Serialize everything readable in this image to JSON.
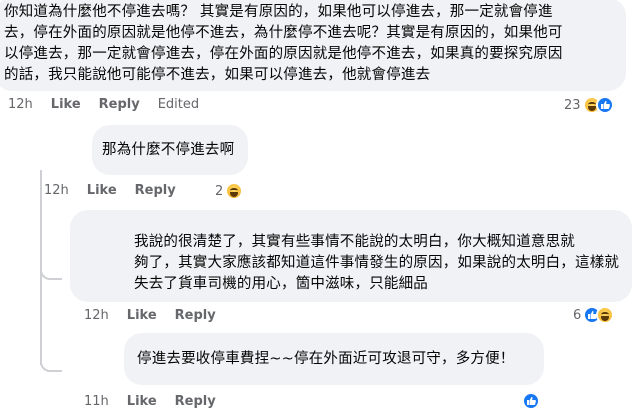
{
  "comments": [
    {
      "lines": [
        "你知道為什麼他不停進去嗎？ 其實是有原因的，如果他可以停進去，那一定就會停進",
        "去，停在外面的原因就是他停不進去，為什麼停不進去呢？其實是有原因的，如果他可",
        "以停進去，那一定就會停進去，停在外面的原因就是他停不進去，如果真的要探究原因",
        "的話，我只能說他可能停不進去，如果可以停進去，他就會停進去"
      ],
      "time": "12h",
      "like": "Like",
      "reply": "Reply",
      "edited": "Edited",
      "reaction_count": "23"
    },
    {
      "lines": [
        "那為什麼不停進去啊"
      ],
      "time": "12h",
      "like": "Like",
      "reply": "Reply",
      "reaction_count": "2"
    },
    {
      "lines": [
        "我說的很清楚了，其實有些事情不能說的太明白，你大概知道意思就",
        "夠了，其實大家應該都知道這件事情發生的原因，如果說的太明白，這樣就",
        "失去了貨車司機的用心，箇中滋味，只能細品"
      ],
      "time": "12h",
      "like": "Like",
      "reply": "Reply",
      "reaction_count": "6"
    },
    {
      "lines": [
        "停進去要收停車費捏~~停在外面近可攻退可守，多方便！"
      ],
      "time": "11h",
      "like": "Like",
      "reply": "Reply"
    }
  ],
  "icons": {
    "haha": "haha-reaction-icon",
    "like": "like-reaction-icon"
  },
  "colors": {
    "bubble": "#f0f2f5",
    "meta": "#65676b",
    "like_blue": "#1877f2",
    "haha_yellow": "#f7b125"
  }
}
